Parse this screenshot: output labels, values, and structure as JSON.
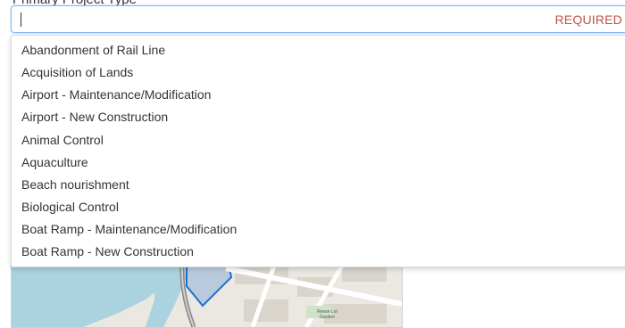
{
  "field": {
    "label": "Primary Project Type",
    "value": "",
    "required_tag": "REQUIRED"
  },
  "dropdown": {
    "options": [
      "Abandonment of Rail Line",
      "Acquisition of Lands",
      "Airport - Maintenance/Modification",
      "Airport - New Construction",
      "Animal Control",
      "Aquaculture",
      "Beach nourishment",
      "Biological Control",
      "Boat Ramp - Maintenance/Modification",
      "Boat Ramp - New Construction"
    ]
  },
  "map": {
    "labels": [
      "Reese Lot",
      "Garden"
    ]
  },
  "colors": {
    "focus_border": "#80bdff",
    "required": "#c0504d",
    "water": "#aad3df",
    "project_area": "#1f6fd1"
  }
}
